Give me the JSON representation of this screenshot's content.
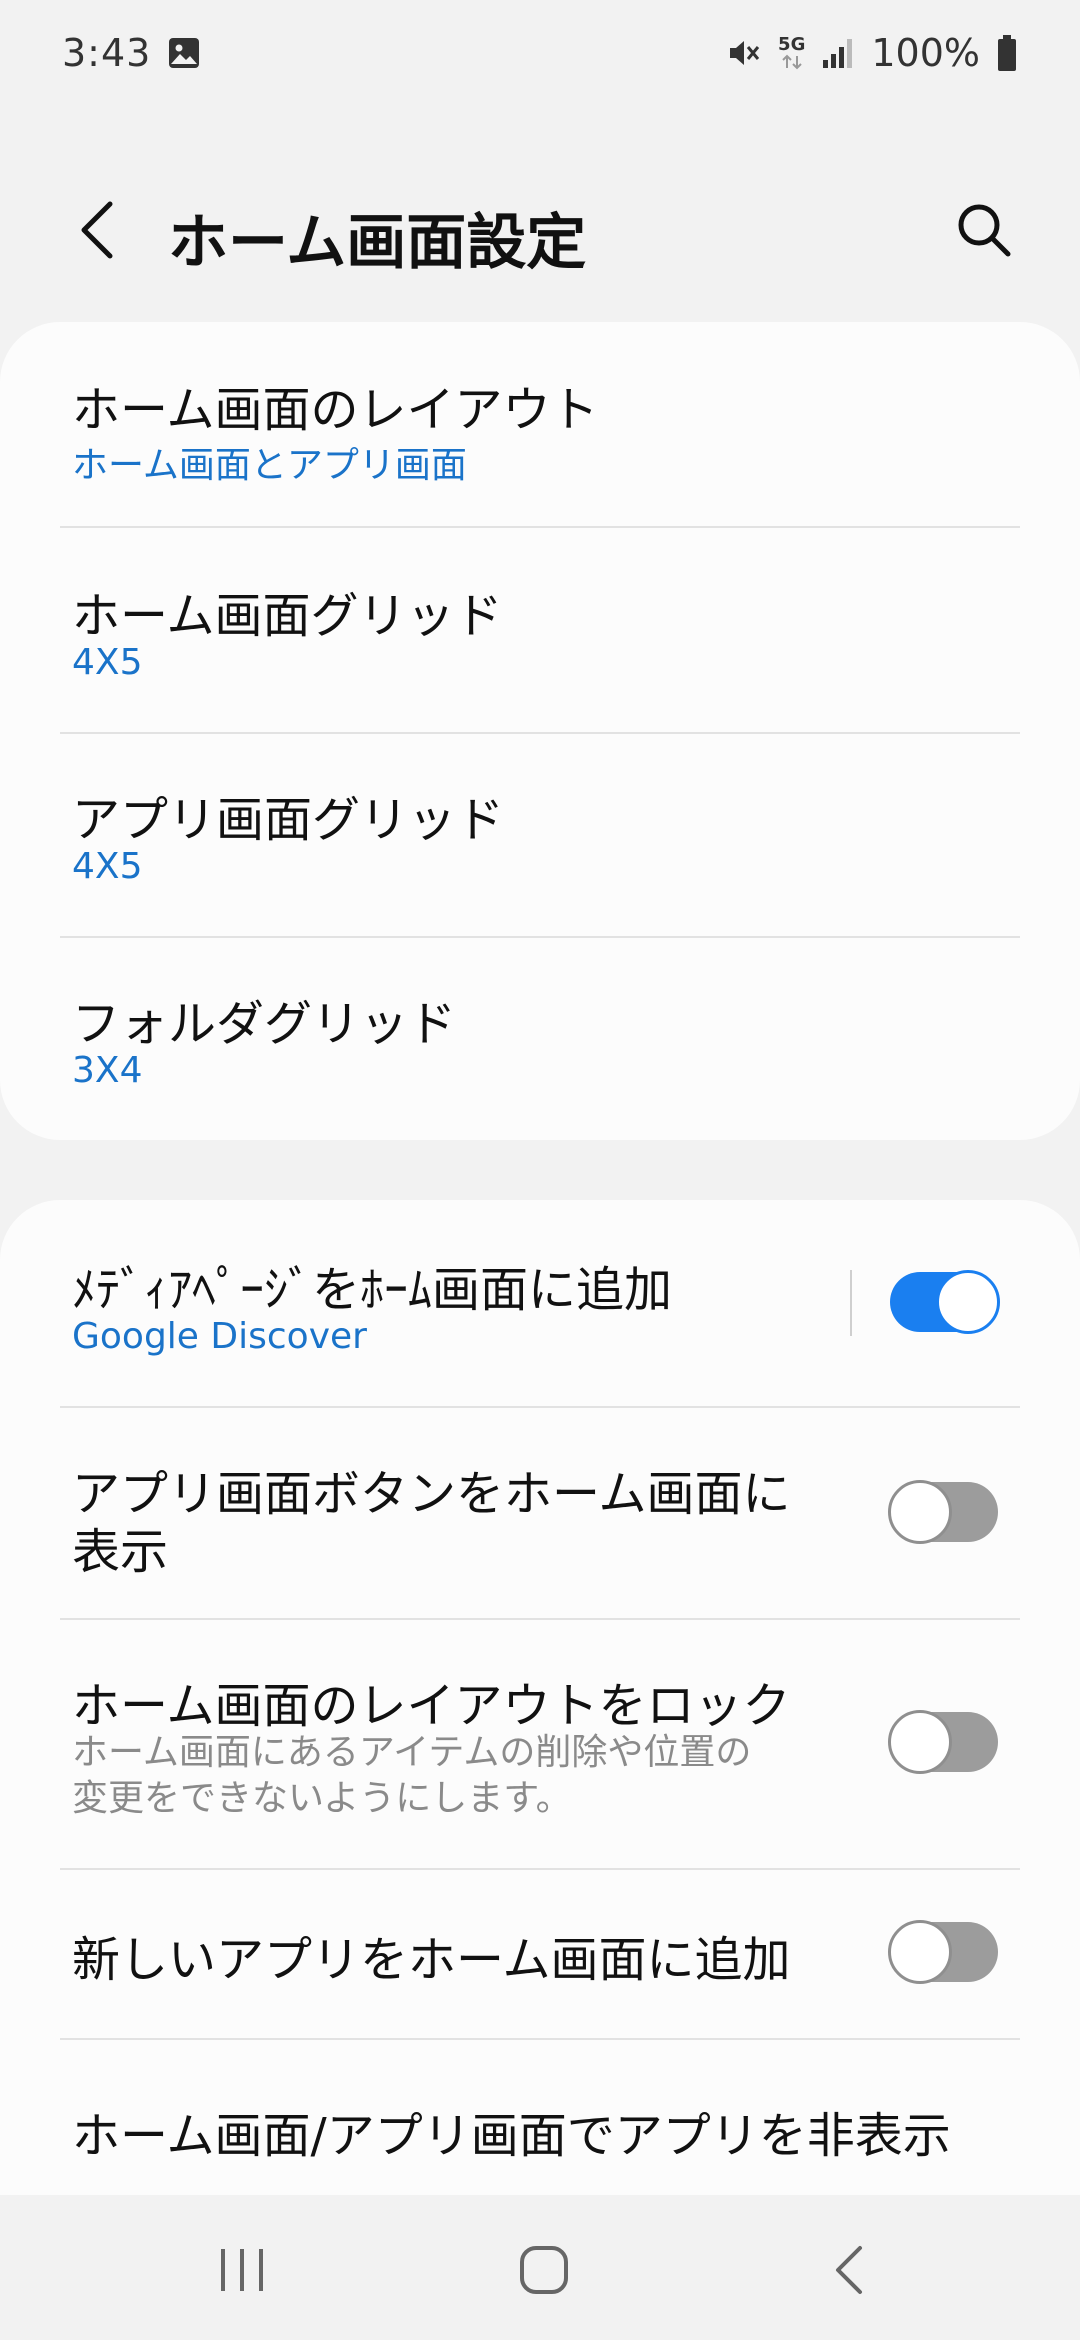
{
  "status_bar": {
    "time": "3:43",
    "network": "5G",
    "battery": "100%",
    "icons": [
      "gallery-icon",
      "mute-icon",
      "signal-icon",
      "battery-icon"
    ]
  },
  "header": {
    "title": "ホーム画面設定",
    "icons": [
      "back-arrow-icon",
      "search-icon"
    ]
  },
  "layout_section": {
    "items": [
      {
        "title": "ホーム画面のレイアウト",
        "value": "ホーム画面とアプリ画面"
      },
      {
        "title": "ホーム画面グリッド",
        "value": "4X5"
      },
      {
        "title": "アプリ画面グリッド",
        "value": "4X5"
      },
      {
        "title": "フォルダグリッド",
        "value": "3X4"
      }
    ]
  },
  "options_section": {
    "items": [
      {
        "title": "ﾒﾃﾞｨｱﾍﾟｰｼﾞをﾎｰﾑ画面に追加",
        "value": "Google Discover",
        "toggle": true
      },
      {
        "title_line1": "アプリ画面ボタンをホーム画面に",
        "title_line2": "表示",
        "toggle": false
      },
      {
        "title": "ホーム画面のレイアウトをロック",
        "desc_line1": "ホーム画面にあるアイテムの削除や位置の",
        "desc_line2": "変更をできないようにします。",
        "toggle": false
      },
      {
        "title": "新しいアプリをホーム画面に追加",
        "toggle": false
      },
      {
        "title": "ホーム画面/アプリ画面でアプリを非表示"
      }
    ]
  },
  "nav_bar": {
    "icons": [
      "recent-apps-icon",
      "home-icon",
      "back-icon"
    ]
  },
  "colors": {
    "accent": "#1a73c9",
    "toggle_on": "#1a7ff0",
    "toggle_off": "#9c9c9c",
    "background": "#f2f2f2",
    "card": "#fcfcfc"
  }
}
